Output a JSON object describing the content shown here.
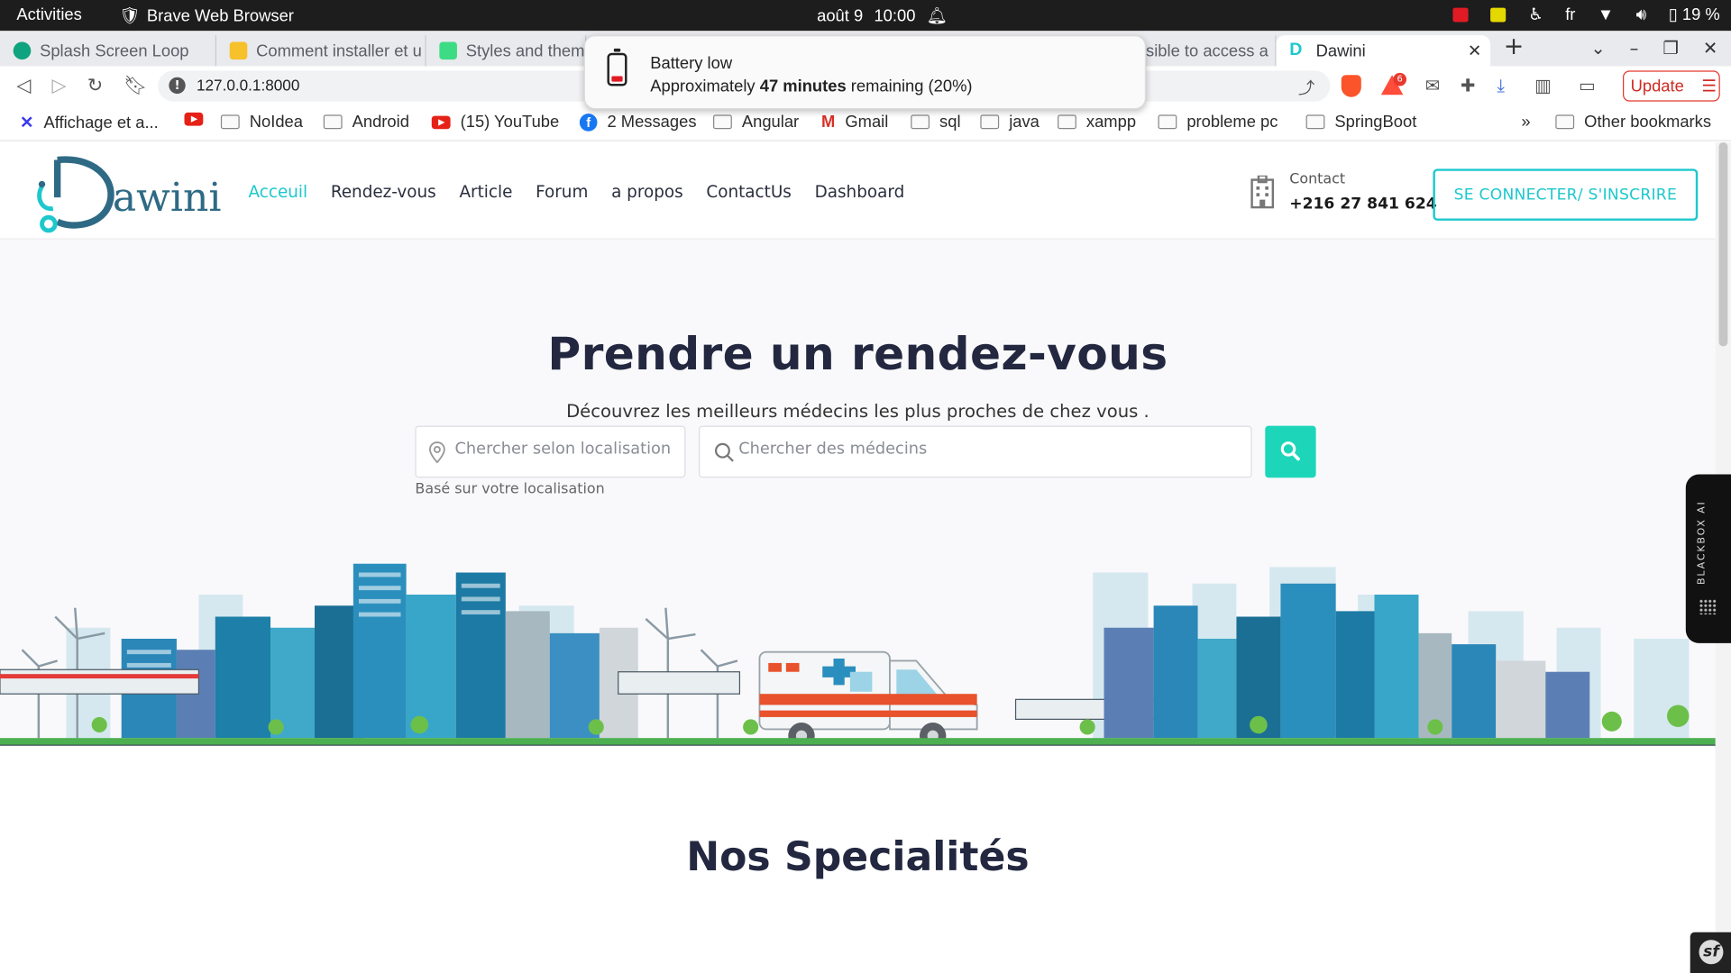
{
  "system_bar": {
    "activities": "Activities",
    "app_name": "Brave Web Browser",
    "date": "août 9",
    "time": "10:00",
    "language": "fr",
    "battery": "19 %"
  },
  "tabs": [
    {
      "title": "Splash Screen Loop",
      "favicon_color": "#10a37f"
    },
    {
      "title": "Comment installer et u",
      "favicon_color": "#f6c12a"
    },
    {
      "title": "Styles and them",
      "favicon_color": "#3ddc84"
    },
    {
      "title": "sible to access a",
      "favicon_color": "#999999"
    },
    {
      "title": "Dawini",
      "favicon_color": "#1dc8cd",
      "active": true
    }
  ],
  "address_bar": {
    "url": "127.0.0.1:8000",
    "update_label": "Update"
  },
  "bookmarks": [
    {
      "label": "Affichage et a...",
      "icon": "x-icon"
    },
    {
      "label": "",
      "icon": "youtube-icon"
    },
    {
      "label": "NoIdea",
      "icon": "folder-icon"
    },
    {
      "label": "Android",
      "icon": "folder-icon"
    },
    {
      "label": "(15) YouTube",
      "icon": "youtube-icon"
    },
    {
      "label": "2 Messages",
      "icon": "facebook-icon"
    },
    {
      "label": "Angular",
      "icon": "folder-icon"
    },
    {
      "label": "Gmail",
      "icon": "gmail-icon"
    },
    {
      "label": "sql",
      "icon": "folder-icon"
    },
    {
      "label": "java",
      "icon": "folder-icon"
    },
    {
      "label": "xampp",
      "icon": "folder-icon"
    },
    {
      "label": "probleme pc",
      "icon": "folder-icon"
    },
    {
      "label": "SpringBoot",
      "icon": "folder-icon"
    }
  ],
  "bookmarks_overflow": "»",
  "other_bookmarks": "Other bookmarks",
  "notification": {
    "title": "Battery low",
    "body_prefix": "Approximately ",
    "body_bold": "47 minutes",
    "body_suffix": " remaining (20%)"
  },
  "site": {
    "logo_text": "awini",
    "nav": [
      {
        "label": "Acceuil",
        "active": true
      },
      {
        "label": "Rendez-vous"
      },
      {
        "label": "Article"
      },
      {
        "label": "Forum"
      },
      {
        "label": "a propos"
      },
      {
        "label": "ContactUs"
      },
      {
        "label": "Dashboard"
      }
    ],
    "contact_label": "Contact",
    "contact_phone": "+216 27 841 624",
    "login_button": "SE CONNECTER/ S'INSCRIRE",
    "accent_color": "#1dc8cd",
    "hero_title": "Prendre un rendez-vous",
    "hero_subtitle": "Découvrez les meilleurs médecins les plus proches de chez vous .",
    "location_placeholder": "Chercher selon localisation",
    "doctor_placeholder": "Chercher des médecins",
    "location_hint": "Basé sur votre localisation",
    "specialties_title": "Nos Specialités"
  },
  "blackbox_label": "BLACKBOX AI"
}
